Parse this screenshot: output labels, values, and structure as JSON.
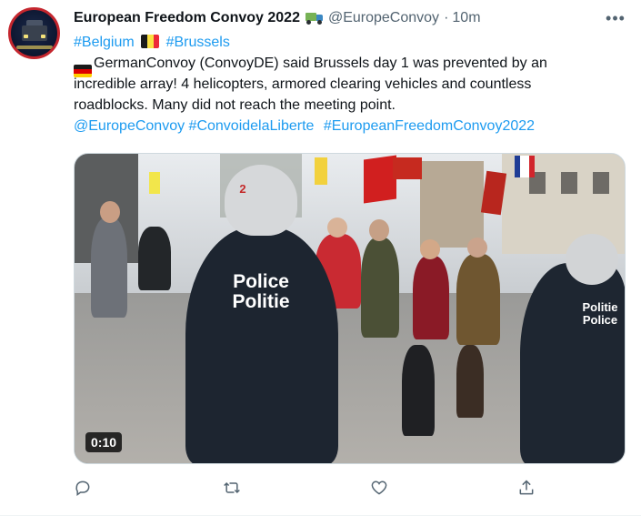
{
  "tweet": {
    "display_name": "European Freedom Convoy 2022",
    "handle": "@EuropeConvoy",
    "separator": "·",
    "time": "10m",
    "hashtag_belgium": "#Belgium",
    "hashtag_brussels": "#Brussels",
    "body_line1": "GermanConvoy (ConvoyDE) said Brussels day 1 was prevented by an",
    "body_line2": "incredible array! 4 helicopters, armored clearing vehicles and countless",
    "body_line3": "roadblocks. Many did not reach the meeting point.",
    "mention": "@EuropeConvoy",
    "hashtag_convoi": "#ConvoidelaLiberte",
    "hashtag_efc": "#EuropeanFreedomConvoy2022",
    "more_icon": "more-dots-icon"
  },
  "media": {
    "video_duration": "0:10",
    "police_label_line1": "Police",
    "police_label_line2": "Politie",
    "helmet_number": "2"
  },
  "actions": {
    "reply_icon": "reply-icon",
    "retweet_icon": "retweet-icon",
    "like_icon": "like-icon",
    "share_icon": "share-icon"
  },
  "colors": {
    "link": "#1d9bf0",
    "text": "#0f1419",
    "secondary": "#536471"
  }
}
